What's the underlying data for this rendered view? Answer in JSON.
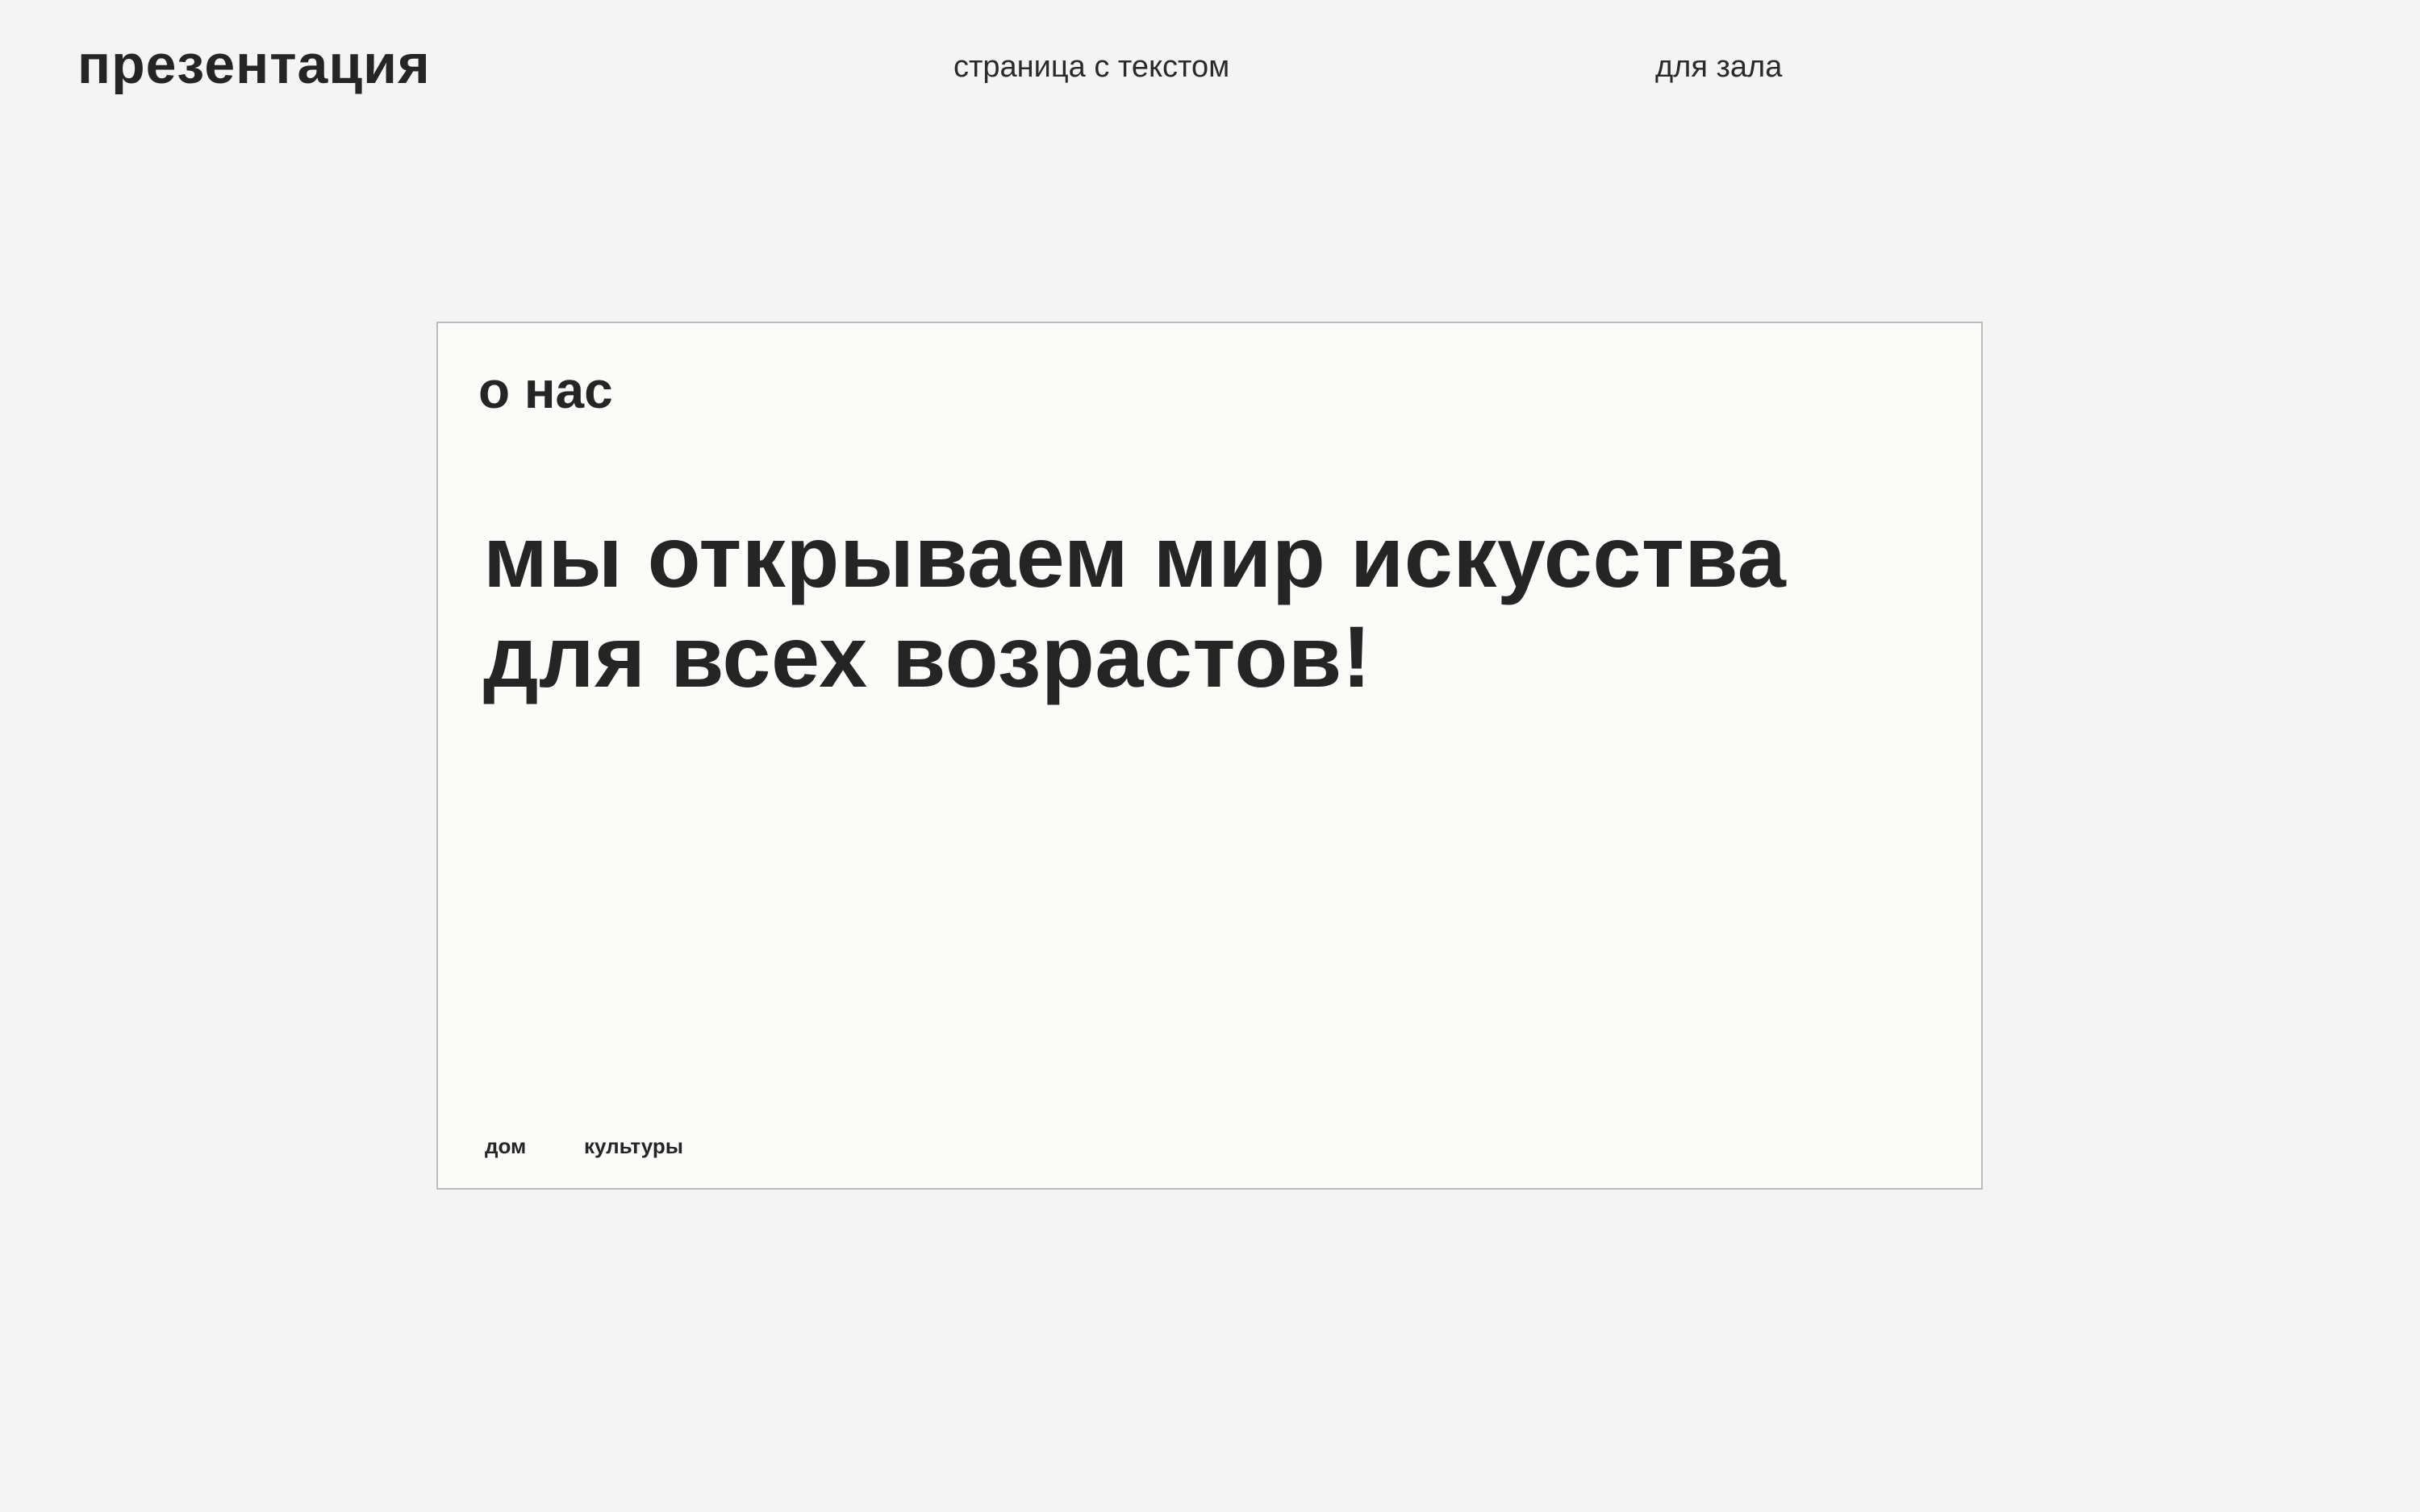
{
  "header": {
    "title": "презентация",
    "subtitle_left": "страница с текстом",
    "subtitle_right": "для зала"
  },
  "slide": {
    "heading": "о нас",
    "lines": [
      "мы открываем мир искусства",
      "для всех возрастов!"
    ],
    "footer": [
      "дом",
      "культуры"
    ]
  },
  "colors": {
    "page_background": "#f4f4f4",
    "slide_background": "#fbfbf9",
    "slide_border": "#bcbcbc",
    "text": "#252525"
  }
}
